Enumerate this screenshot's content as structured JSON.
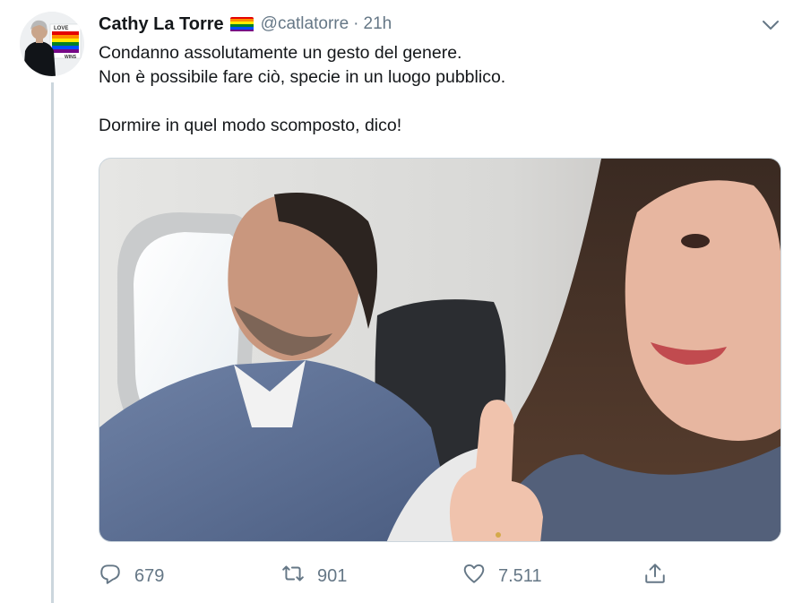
{
  "tweet": {
    "author": {
      "display_name": "Cathy La Torre",
      "handle": "@catlatorre",
      "badge_icon": "rainbow-flag-icon",
      "avatar_text": [
        "LOVE",
        "WINS"
      ]
    },
    "separator": "·",
    "time": "21h",
    "text_lines": [
      "Condanno assolutamente un gesto del genere.",
      "Non è possibile fare ciò, specie in un luogo pubblico.",
      "",
      "Dormire in quel modo scomposto, dico!"
    ],
    "actions": {
      "reply_count": "679",
      "retweet_count": "901",
      "like_count": "7.511",
      "icons": [
        "reply-icon",
        "retweet-icon",
        "like-icon",
        "share-icon"
      ]
    },
    "more_icon": "chevron-down-icon",
    "colors": {
      "name": "#14171a",
      "secondary": "#657786",
      "thread_line": "#ccd6dd",
      "flag": [
        "#e40303",
        "#ff8c00",
        "#ffed00",
        "#008026",
        "#004dff",
        "#750787"
      ]
    }
  }
}
